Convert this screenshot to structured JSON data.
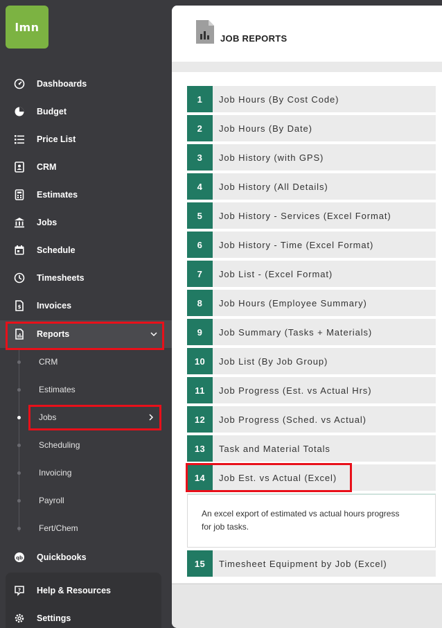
{
  "logo": {
    "text": "lmn",
    "color": "#7cb342"
  },
  "sidebar": {
    "items": [
      {
        "label": "Dashboards",
        "icon": "gauge-icon"
      },
      {
        "label": "Budget",
        "icon": "pie-chart-icon"
      },
      {
        "label": "Price List",
        "icon": "list-icon"
      },
      {
        "label": "CRM",
        "icon": "contact-card-icon"
      },
      {
        "label": "Estimates",
        "icon": "calculator-icon"
      },
      {
        "label": "Jobs",
        "icon": "bank-icon"
      },
      {
        "label": "Schedule",
        "icon": "calendar-icon"
      },
      {
        "label": "Timesheets",
        "icon": "clock-icon"
      },
      {
        "label": "Invoices",
        "icon": "invoice-icon"
      },
      {
        "label": "Reports",
        "icon": "report-icon"
      }
    ],
    "reports_sub": [
      {
        "label": "CRM"
      },
      {
        "label": "Estimates"
      },
      {
        "label": "Jobs"
      },
      {
        "label": "Scheduling"
      },
      {
        "label": "Invoicing"
      },
      {
        "label": "Payroll"
      },
      {
        "label": "Fert/Chem"
      }
    ],
    "bottom_items": [
      {
        "label": "Quickbooks",
        "icon": "quickbooks-icon"
      },
      {
        "label": "Help & Resources",
        "icon": "help-icon"
      },
      {
        "label": "Settings",
        "icon": "gear-icon"
      }
    ]
  },
  "header": {
    "title": "JOB REPORTS"
  },
  "reports": [
    {
      "num": "1",
      "label": "Job Hours (By Cost Code)"
    },
    {
      "num": "2",
      "label": "Job Hours (By Date)"
    },
    {
      "num": "3",
      "label": "Job History (with GPS)"
    },
    {
      "num": "4",
      "label": "Job History (All Details)"
    },
    {
      "num": "5",
      "label": "Job History - Services (Excel Format)"
    },
    {
      "num": "6",
      "label": "Job History - Time (Excel Format)"
    },
    {
      "num": "7",
      "label": "Job List - (Excel Format)"
    },
    {
      "num": "8",
      "label": "Job Hours (Employee Summary)"
    },
    {
      "num": "9",
      "label": "Job Summary (Tasks + Materials)"
    },
    {
      "num": "10",
      "label": "Job List (By Job Group)"
    },
    {
      "num": "11",
      "label": "Job Progress (Est. vs Actual Hrs)"
    },
    {
      "num": "12",
      "label": "Job Progress (Sched. vs Actual)"
    },
    {
      "num": "13",
      "label": "Task and Material Totals"
    },
    {
      "num": "14",
      "label": "Job Est. vs Actual (Excel)"
    },
    {
      "num": "15",
      "label": "Timesheet Equipment by Job (Excel)"
    }
  ],
  "expanded_description": "An excel export of estimated vs actual hours progress for job tasks.",
  "colors": {
    "accent": "#217a63",
    "highlight": "#e8101a",
    "sidebar": "#3a3a3e"
  }
}
